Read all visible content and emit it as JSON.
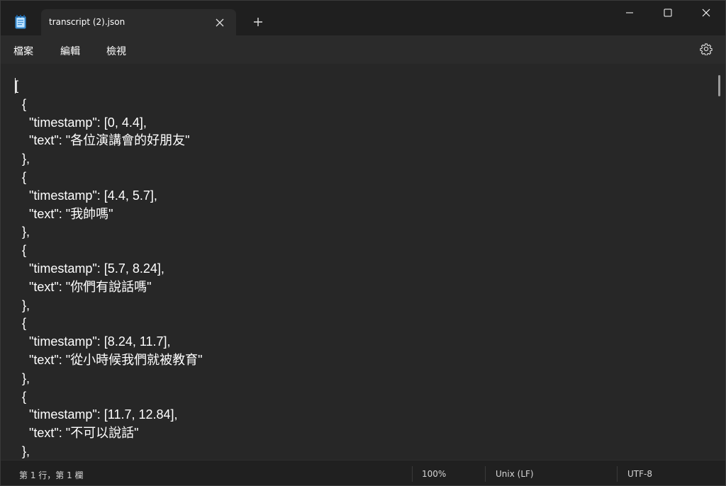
{
  "app": {
    "name": "Notepad",
    "icon": "notepad-icon",
    "accent_color": "#3a8fd6"
  },
  "tab": {
    "title": "transcript (2).json",
    "close_icon": "close-icon"
  },
  "new_tab_icon": "plus-icon",
  "window_controls": [
    "minimize-icon",
    "maximize-icon",
    "close-icon"
  ],
  "menu": {
    "file": "檔案",
    "edit": "編輯",
    "view": "檢視",
    "settings_icon": "gear-icon"
  },
  "editor": {
    "lines": [
      "[",
      "  {",
      "    \"timestamp\": [0, 4.4],",
      "    \"text\": \"各位演講會的好朋友\"",
      "  },",
      "  {",
      "    \"timestamp\": [4.4, 5.7],",
      "    \"text\": \"我帥嗎\"",
      "  },",
      "  {",
      "    \"timestamp\": [5.7, 8.24],",
      "    \"text\": \"你們有說話嗎\"",
      "  },",
      "  {",
      "    \"timestamp\": [8.24, 11.7],",
      "    \"text\": \"從小時候我們就被教育\"",
      "  },",
      "  {",
      "    \"timestamp\": [11.7, 12.84],",
      "    \"text\": \"不可以說話\"",
      "  },"
    ]
  },
  "status": {
    "position": "第 1 行，第 1 欄",
    "zoom": "100%",
    "line_ending": "Unix (LF)",
    "encoding": "UTF-8"
  }
}
